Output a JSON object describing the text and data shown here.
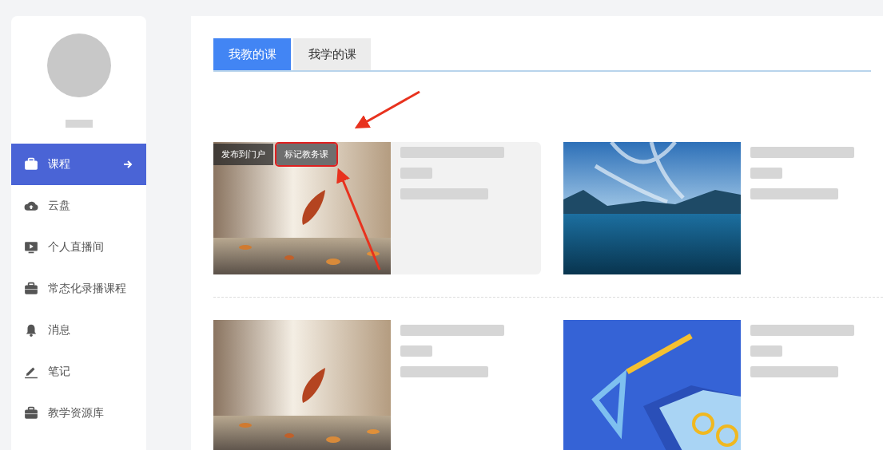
{
  "sidebar": {
    "items": [
      {
        "label": "课程",
        "kind": "briefcase",
        "selected": true
      },
      {
        "label": "云盘",
        "kind": "cloud",
        "selected": false
      },
      {
        "label": "个人直播间",
        "kind": "monitor",
        "selected": false
      },
      {
        "label": "常态化录播课程",
        "kind": "briefcase",
        "selected": false
      },
      {
        "label": "消息",
        "kind": "bell",
        "selected": false
      },
      {
        "label": "笔记",
        "kind": "pen",
        "selected": false
      },
      {
        "label": "教学资源库",
        "kind": "briefcase",
        "selected": false
      }
    ]
  },
  "tabs": [
    {
      "label": "我教的课",
      "selected": true
    },
    {
      "label": "我学的课",
      "selected": false
    }
  ],
  "courses": [
    {
      "kind": "leaf",
      "badges": [
        {
          "label": "发布到门户",
          "highlighted": false
        },
        {
          "label": "标记教务课",
          "highlighted": true
        }
      ],
      "hovered": true
    },
    {
      "kind": "lake",
      "hovered": false
    },
    {
      "kind": "leaf",
      "hovered": false
    },
    {
      "kind": "book",
      "hovered": false
    }
  ]
}
